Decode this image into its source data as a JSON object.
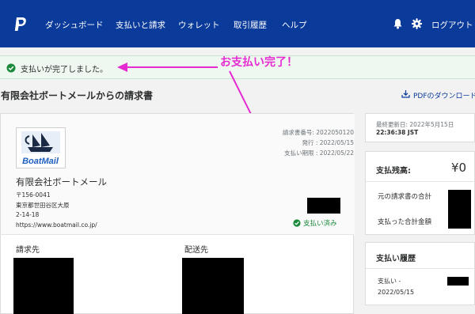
{
  "nav": {
    "items": [
      "ダッシュボード",
      "支払いと請求",
      "ウォレット",
      "取引履歴",
      "ヘルプ"
    ],
    "logout": "ログアウト",
    "bell_icon": "bell-icon",
    "gear_icon": "gear-icon"
  },
  "banner": {
    "message": "支払いが完了しました。"
  },
  "annotation": {
    "text": "お支払い完了！",
    "color": "#e62ad2"
  },
  "invoice": {
    "title": "有限会社ボートメールからの請求書",
    "pdf_label": "PDFのダウンロード",
    "number": "請求書番号: 2022050120",
    "issued": "発行 : 2022/05/15",
    "due": "支払い期限 : 2022/05/22",
    "status": "支払い済み"
  },
  "merchant": {
    "logo_text": "BoatMail",
    "name": "有限会社ボートメール",
    "postal": "〒156-0041",
    "address1": "東京都世田谷区大原",
    "address2": "2-14-18",
    "url": "https://www.boatmail.co.jp/"
  },
  "sections": {
    "bill_to": "請求先",
    "ship_to": "配送先"
  },
  "sidebar": {
    "updated_label": "最終更新日: 2022年5月15日",
    "updated_time": "22:36:38 JST",
    "balance_label": "支払残高:",
    "balance_value": "¥0",
    "original_total": "元の請求書の合計",
    "paid_total": "支払った合計金額",
    "history_title": "支払い履歴",
    "history_item": "支払い -",
    "history_date": "2022/05/15"
  },
  "colors": {
    "nav_bg": "#0a3a9a",
    "success": "#1a8a3a",
    "banner_bg": "#eef7f0"
  }
}
